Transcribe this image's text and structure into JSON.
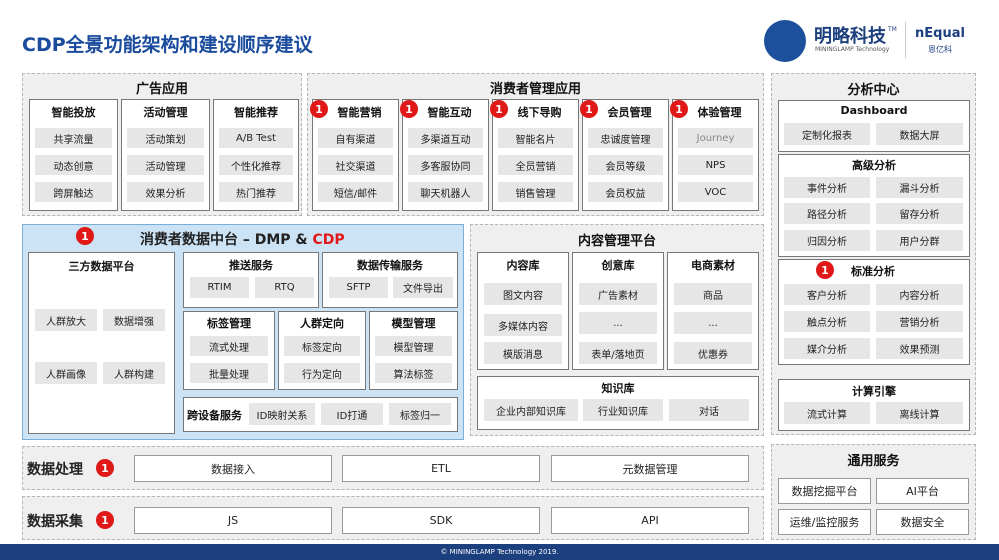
{
  "title": "CDP全景功能架构和建设顺序建议",
  "logo": {
    "name": "明略科技",
    "sub": "MININGLAMP Technology",
    "tm": "TM",
    "brand": "nEqual",
    "brand_sub": "恩亿科"
  },
  "badge": "1",
  "ad": {
    "title": "广告应用",
    "cols": [
      {
        "h": "智能投放",
        "items": [
          "共享流量",
          "动态创意",
          "跨屏触达"
        ]
      },
      {
        "h": "活动管理",
        "items": [
          "活动策划",
          "活动管理",
          "效果分析"
        ]
      },
      {
        "h": "智能推荐",
        "items": [
          "A/B Test",
          "个性化推荐",
          "热门推荐"
        ]
      }
    ]
  },
  "consumer": {
    "title": "消费者管理应用",
    "cols": [
      {
        "h": "智能营销",
        "items": [
          "自有渠道",
          "社交渠道",
          "短信/邮件"
        ]
      },
      {
        "h": "智能互动",
        "items": [
          "多渠道互动",
          "多客服协同",
          "聊天机器人"
        ]
      },
      {
        "h": "线下导购",
        "items": [
          "智能名片",
          "全员营销",
          "销售管理"
        ]
      },
      {
        "h": "会员管理",
        "items": [
          "忠诚度管理",
          "会员等级",
          "会员权益"
        ]
      },
      {
        "h": "体验管理",
        "items": [
          "Journey",
          "NPS",
          "VOC"
        ]
      }
    ]
  },
  "analysis": {
    "title": "分析中心",
    "dashboard": {
      "h": "Dashboard",
      "items": [
        "定制化报表",
        "数据大屏"
      ]
    },
    "advanced": {
      "h": "高级分析",
      "items": [
        "事件分析",
        "漏斗分析",
        "路径分析",
        "留存分析",
        "归因分析",
        "用户分群"
      ]
    },
    "standard": {
      "h": "标准分析",
      "items": [
        "客户分析",
        "内容分析",
        "触点分析",
        "营销分析",
        "媒介分析",
        "效果预测"
      ]
    },
    "compute": {
      "h": "计算引擎",
      "items": [
        "流式计算",
        "离线计算"
      ]
    }
  },
  "dmp": {
    "title_a": "消费者数据中台 – DMP & ",
    "title_b": "CDP",
    "third": {
      "h": "三方数据平台",
      "items": [
        "人群放大",
        "数据增强",
        "人群画像",
        "人群构建"
      ]
    },
    "push": {
      "h": "推送服务",
      "items": [
        "RTIM",
        "RTQ"
      ]
    },
    "trans": {
      "h": "数据传输服务",
      "items": [
        "SFTP",
        "文件导出"
      ]
    },
    "tag": {
      "h": "标签管理",
      "items": [
        "流式处理",
        "批量处理"
      ]
    },
    "crowd": {
      "h": "人群定向",
      "items": [
        "标签定向",
        "行为定向"
      ]
    },
    "model": {
      "h": "模型管理",
      "items": [
        "模型管理",
        "算法标签"
      ]
    },
    "cross": {
      "h": "跨设备服务",
      "items": [
        "ID映射关系",
        "ID打通",
        "标签归一"
      ]
    }
  },
  "content": {
    "title": "内容管理平台",
    "lib": {
      "h": "内容库",
      "items": [
        "图文内容",
        "多媒体内容",
        "模版消息"
      ]
    },
    "creative": {
      "h": "创意库",
      "items": [
        "广告素材",
        "...",
        "表单/落地页"
      ]
    },
    "ecom": {
      "h": "电商素材",
      "items": [
        "商品",
        "...",
        "优惠券"
      ]
    },
    "knowledge": {
      "h": "知识库",
      "items": [
        "企业内部知识库",
        "行业知识库",
        "对话"
      ]
    }
  },
  "processing": {
    "label": "数据处理",
    "items": [
      "数据接入",
      "ETL",
      "元数据管理"
    ]
  },
  "collection": {
    "label": "数据采集",
    "items": [
      "JS",
      "SDK",
      "API"
    ]
  },
  "general": {
    "title": "通用服务",
    "items": [
      "数据挖掘平台",
      "AI平台",
      "运维/监控服务",
      "数据安全"
    ]
  },
  "footer": "© MININGLAMP Technology 2019.",
  "colors": {
    "accent": "#1a4b9c",
    "badge": "#e01818",
    "dmp_bg": "#cce3f6",
    "cdp_red": "#e01818"
  }
}
